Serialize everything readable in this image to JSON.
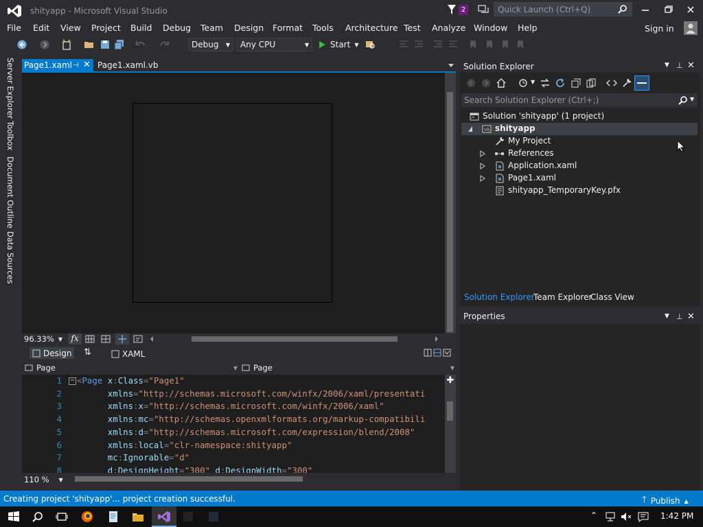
{
  "window": {
    "title": "shityapp - Microsoft Visual Studio",
    "notification_count": "2",
    "quick_launch_placeholder": "Quick Launch (Ctrl+Q)"
  },
  "menu": {
    "items": [
      "File",
      "Edit",
      "View",
      "Project",
      "Build",
      "Debug",
      "Team",
      "Design",
      "Format",
      "Tools",
      "Architecture",
      "Test",
      "Analyze",
      "Window",
      "Help"
    ],
    "signin": "Sign in"
  },
  "toolbar": {
    "config": "Debug",
    "platform": "Any CPU",
    "start_label": "Start"
  },
  "left_tabs": [
    "Server Explorer",
    "Toolbox",
    "Document Outline",
    "Data Sources"
  ],
  "doc_tabs": {
    "active": "Page1.xaml",
    "second": "Page1.xaml.vb"
  },
  "designer": {
    "zoom": "96.33%",
    "fx_label": "fx"
  },
  "split": {
    "design_label": "Design",
    "xaml_label": "XAML"
  },
  "navbar": {
    "left": "Page",
    "right": "Page"
  },
  "editor": {
    "zoom": "110 %",
    "lines": [
      {
        "n": "1",
        "parts": [
          [
            "t-pun",
            "<"
          ],
          [
            "t-el",
            "Page"
          ],
          [
            "",
            " "
          ],
          [
            "t-attr",
            "x"
          ],
          [
            "t-pun",
            ":"
          ],
          [
            "t-attr",
            "Class"
          ],
          [
            "t-pun",
            "="
          ],
          [
            "t-str",
            "\"Page1\""
          ]
        ]
      },
      {
        "n": "2",
        "parts": [
          [
            "",
            "      "
          ],
          [
            "t-attr",
            "xmlns"
          ],
          [
            "t-pun",
            "="
          ],
          [
            "t-str",
            "\"http://schemas.microsoft.com/winfx/2006/xaml/presentati"
          ]
        ]
      },
      {
        "n": "3",
        "parts": [
          [
            "",
            "      "
          ],
          [
            "t-attr",
            "xmlns"
          ],
          [
            "t-pun",
            ":"
          ],
          [
            "t-attr",
            "x"
          ],
          [
            "t-pun",
            "="
          ],
          [
            "t-str",
            "\"http://schemas.microsoft.com/winfx/2006/xaml\""
          ]
        ]
      },
      {
        "n": "4",
        "parts": [
          [
            "",
            "      "
          ],
          [
            "t-attr",
            "xmlns"
          ],
          [
            "t-pun",
            ":"
          ],
          [
            "t-attr",
            "mc"
          ],
          [
            "t-pun",
            "="
          ],
          [
            "t-str",
            "\"http://schemas.openxmlformats.org/markup-compatibili"
          ]
        ]
      },
      {
        "n": "5",
        "parts": [
          [
            "",
            "      "
          ],
          [
            "t-attr",
            "xmlns"
          ],
          [
            "t-pun",
            ":"
          ],
          [
            "t-attr",
            "d"
          ],
          [
            "t-pun",
            "="
          ],
          [
            "t-str",
            "\"http://schemas.microsoft.com/expression/blend/2008\""
          ]
        ]
      },
      {
        "n": "6",
        "parts": [
          [
            "",
            "      "
          ],
          [
            "t-attr",
            "xmlns"
          ],
          [
            "t-pun",
            ":"
          ],
          [
            "t-attr",
            "local"
          ],
          [
            "t-pun",
            "="
          ],
          [
            "t-str",
            "\"clr-namespace:shityapp\""
          ]
        ]
      },
      {
        "n": "7",
        "parts": [
          [
            "",
            "      "
          ],
          [
            "t-attr",
            "mc"
          ],
          [
            "t-pun",
            ":"
          ],
          [
            "t-attr",
            "Ignorable"
          ],
          [
            "t-pun",
            "="
          ],
          [
            "t-str",
            "\"d\""
          ]
        ]
      },
      {
        "n": "8",
        "parts": [
          [
            "",
            "      "
          ],
          [
            "t-attr",
            "d"
          ],
          [
            "t-pun",
            ":"
          ],
          [
            "t-attr",
            "DesignHeight"
          ],
          [
            "t-pun",
            "="
          ],
          [
            "t-str",
            "\"300\""
          ],
          [
            "",
            " "
          ],
          [
            "t-attr",
            "d"
          ],
          [
            "t-pun",
            ":"
          ],
          [
            "t-attr",
            "DesignWidth"
          ],
          [
            "t-pun",
            "="
          ],
          [
            "t-str",
            "\"300\""
          ]
        ]
      }
    ]
  },
  "solution_explorer": {
    "title": "Solution Explorer",
    "search_placeholder": "Search Solution Explorer (Ctrl+;)",
    "solution": "Solution 'shityapp' (1 project)",
    "project": "shityapp",
    "items": [
      "My Project",
      "References",
      "Application.xaml",
      "Page1.xaml",
      "shityapp_TemporaryKey.pfx"
    ],
    "bottom_tabs": [
      "Solution Explorer",
      "Team Explorer",
      "Class View"
    ]
  },
  "properties": {
    "title": "Properties"
  },
  "status": {
    "text": "Creating project 'shityapp'... project creation successful.",
    "publish": "Publish"
  },
  "taskbar": {
    "clock": "1:42 PM"
  },
  "colors": {
    "accent": "#007acc",
    "badge": "#68217a",
    "background": "#2d2d30"
  }
}
